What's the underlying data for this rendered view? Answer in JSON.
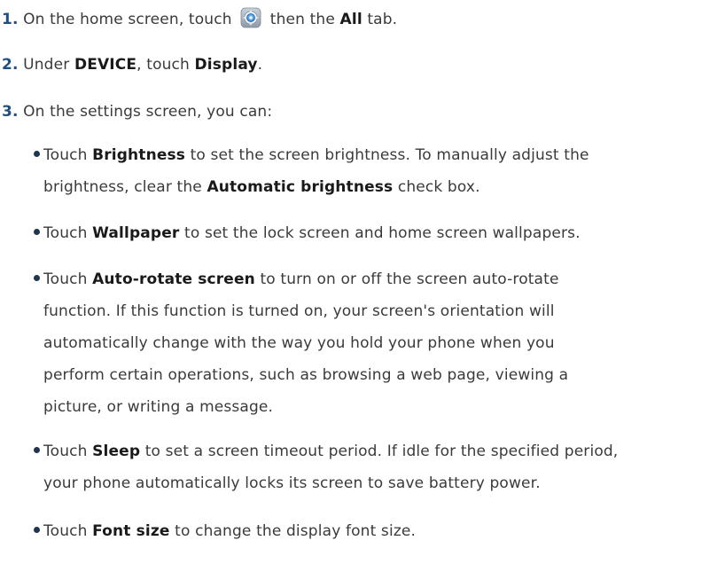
{
  "steps": [
    {
      "number": "1.",
      "text_a": "On the home screen, touch",
      "icon": "settings-gear-icon",
      "text_b": "then the",
      "bold_a": "All",
      "text_c": "tab."
    },
    {
      "number": "2.",
      "text_a": "Under",
      "bold_a": "DEVICE",
      "text_b": ", touch",
      "bold_b": "Display",
      "text_c": "."
    },
    {
      "number": "3.",
      "text_a": "On the settings screen, you can:"
    }
  ],
  "bullets": [
    {
      "lines": [
        {
          "pre": "Touch ",
          "bold": "Brightness",
          "post": " to set the screen brightness. To manually adjust the"
        },
        {
          "pre": "brightness, clear the ",
          "bold": "Automatic brightness",
          "post": " check box."
        }
      ]
    },
    {
      "lines": [
        {
          "pre": "Touch ",
          "bold": "Wallpaper",
          "post": " to set the lock screen and home screen wallpapers."
        }
      ]
    },
    {
      "lines": [
        {
          "pre": "Touch ",
          "bold": "Auto-rotate screen",
          "post": " to turn on or off the screen auto-rotate"
        },
        {
          "pre": "function. If this function is turned on, your screen's orientation will",
          "bold": "",
          "post": ""
        },
        {
          "pre": "automatically change with the way you hold your phone when you",
          "bold": "",
          "post": ""
        },
        {
          "pre": "perform certain operations, such as browsing a web page, viewing a",
          "bold": "",
          "post": ""
        },
        {
          "pre": "picture, or writing a message.",
          "bold": "",
          "post": ""
        }
      ]
    },
    {
      "lines": [
        {
          "pre": "Touch ",
          "bold": "Sleep",
          "post": " to set a screen timeout period. If idle for the specified period,"
        },
        {
          "pre": "your phone automatically locks its screen to save battery power.",
          "bold": "",
          "post": ""
        }
      ]
    },
    {
      "lines": [
        {
          "pre": "Touch ",
          "bold": "Font size",
          "post": " to change the display font size."
        }
      ]
    }
  ]
}
